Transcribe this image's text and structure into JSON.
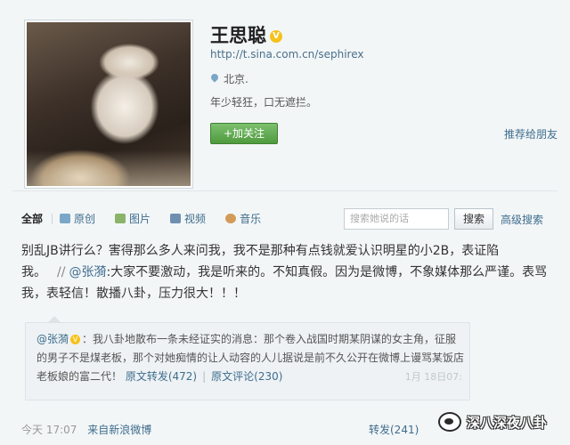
{
  "profile": {
    "name": "王思聪",
    "verified_badge": "V",
    "url": "http://t.sina.com.cn/sephirex",
    "location": "北京.",
    "bio": "年少轻狂，口无遮拦。",
    "follow_label": "+加关注",
    "recommend_label": "推荐给朋友"
  },
  "tabs": [
    {
      "label": "全部",
      "icon": ""
    },
    {
      "label": "原创",
      "icon": "original-icon"
    },
    {
      "label": "图片",
      "icon": "image-icon"
    },
    {
      "label": "视频",
      "icon": "video-icon"
    },
    {
      "label": "音乐",
      "icon": "music-icon"
    }
  ],
  "search": {
    "placeholder": "搜索她说的话",
    "button_label": "搜索",
    "advanced_label": "高级搜索"
  },
  "post": {
    "text_main": "别乱JB讲行么？害得那么多人来问我，我不是那种有点钱就爱认识明星的小2B，表证陷我。",
    "separator": "//",
    "mention": "@张漪",
    "text_repost": ":大家不要激动，我是听来的。不知真假。因为是微博，不象媒体那么严谨。表骂我，表轻信！散播八卦，压力很大！！！"
  },
  "quote": {
    "author": "@张漪",
    "badge": "V",
    "text": "：我八卦地散布一条未经证实的消息：那个卷入战国时期某阴谋的女主角，征服的男子不是煤老板，那个对她痴情的让人动容的人儿据说是前不久公开在微博上谩骂某饭店老板娘的富二代！",
    "repost_label": "原文转发(472)",
    "comment_label": "原文评论(230)",
    "right_meta": "1月 18日07:"
  },
  "meta": {
    "time": "今天 17:07",
    "source": "来自新浪微博",
    "repost_label": "转发(241)"
  },
  "watermark": {
    "text": "深八深夜八卦"
  },
  "colors": {
    "link": "#3e6d8e",
    "follow_green": "#4e9a3e",
    "verified_yellow": "#f6c21b"
  }
}
